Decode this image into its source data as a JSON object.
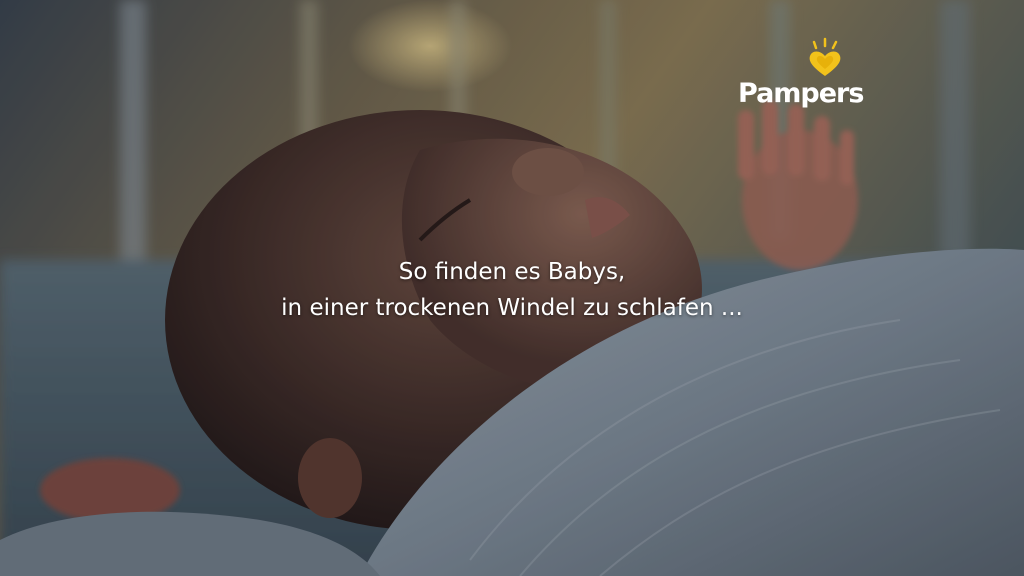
{
  "brand": {
    "logo_text": "Pampers"
  },
  "subtitle": {
    "line1": "So finden es Babys,",
    "line2": "in einer trockenen Windel zu schlafen ..."
  },
  "colors": {
    "logo_heart": "#f2c21b",
    "subtitle_text": "#ffffff"
  }
}
